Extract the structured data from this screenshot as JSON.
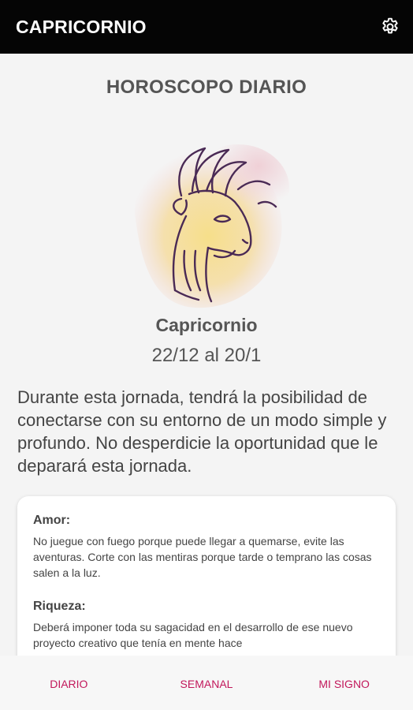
{
  "app": {
    "title": "CAPRICORNIO",
    "settings_icon": "gear-icon"
  },
  "main": {
    "section_title": "HOROSCOPO DIARIO",
    "sign_image": "capricorn-goat-illustration",
    "sign_name": "Capricornio",
    "sign_dates": "22/12 al 20/1",
    "daily_text": "Durante esta jornada, tendrá la posibilidad de conectarse con su entorno de un modo simple y profundo. No desperdicie la oportunidad que le deparará esta jornada.",
    "details": [
      {
        "heading": "Amor:",
        "body": "No juegue con fuego porque puede llegar a quemarse, evite las aventuras. Corte con las mentiras porque tarde o temprano las cosas salen a la luz."
      },
      {
        "heading": "Riqueza:",
        "body": "Deberá imponer toda su sagacidad en el desarrollo de ese nuevo proyecto creativo que tenía en mente hace"
      }
    ]
  },
  "bottom_nav": {
    "items": [
      {
        "label": "DIARIO"
      },
      {
        "label": "SEMANAL"
      },
      {
        "label": "MI SIGNO"
      }
    ]
  },
  "colors": {
    "appbar": "#050505",
    "accent": "#c2185b",
    "background": "#f4f4f4"
  }
}
